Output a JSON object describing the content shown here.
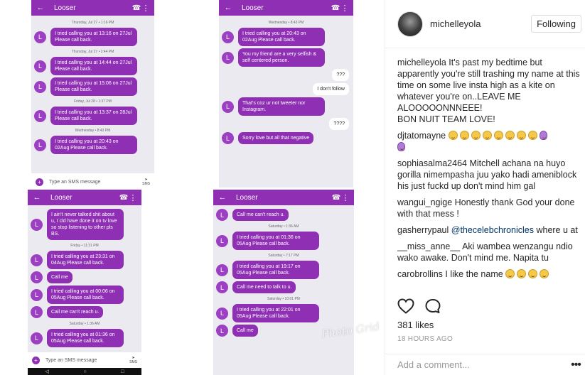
{
  "phones": [
    {
      "title": "Looser",
      "items": [
        {
          "kind": "stamp",
          "text": "Thursday, Jul 27 • 1:16 PM"
        },
        {
          "kind": "in",
          "text": "I tried calling you at 13:16 on 27Jul  Please call back."
        },
        {
          "kind": "stamp",
          "text": "Thursday, Jul 27 • 2:44 PM"
        },
        {
          "kind": "in",
          "text": "I tried calling you at 14:44 on 27Jul  Please call back."
        },
        {
          "kind": "in",
          "text": "I tried calling you at 15:06 on 27Jul  Please call back."
        },
        {
          "kind": "stamp",
          "text": "Friday, Jul 28 • 1:37 PM"
        },
        {
          "kind": "in",
          "text": "I tried calling you at 13:37 on 28Jul  Please call back."
        },
        {
          "kind": "stamp",
          "text": "Wednesday • 8:43 PM"
        },
        {
          "kind": "in",
          "text": "I tried calling you at 20:43 on 02Aug  Please call back."
        }
      ],
      "composer": "Type an SMS message",
      "send": "SMS"
    },
    {
      "title": "Looser",
      "items": [
        {
          "kind": "stamp",
          "text": "Wednesday • 8:43 PM"
        },
        {
          "kind": "in",
          "text": "I tried calling you at 20:43 on 02Aug  Please call back."
        },
        {
          "kind": "in",
          "text": "You my friend are a very selfish & self centered person."
        },
        {
          "kind": "out",
          "text": "???"
        },
        {
          "kind": "out",
          "text": "I don't follow"
        },
        {
          "kind": "in",
          "text": "That's coz ur not tweeter nor Instagram."
        },
        {
          "kind": "out",
          "text": "????"
        },
        {
          "kind": "in",
          "text": "Sorry love but all that negative"
        }
      ]
    },
    {
      "title": "Looser",
      "items": [
        {
          "kind": "in",
          "text": "I ain't never talked shit about u, I cld have done it on tv love so stop listening to other pls BS."
        },
        {
          "kind": "stamp",
          "text": "Friday • 11:31 PM"
        },
        {
          "kind": "in",
          "text": "I tried calling you at 23:31 on 04Aug  Please call back."
        },
        {
          "kind": "in",
          "text": "Call me"
        },
        {
          "kind": "in",
          "text": "I tried calling you at 00:06 on 05Aug  Please call back."
        },
        {
          "kind": "in",
          "text": "Call me can't reach u."
        },
        {
          "kind": "stamp",
          "text": "Saturday • 1:36 AM"
        },
        {
          "kind": "in",
          "text": "I tried calling you at 01:36 on 05Aug  Please call back."
        }
      ],
      "composer": "Type an SMS message",
      "send": "SMS"
    },
    {
      "title": "Looser",
      "items": [
        {
          "kind": "in",
          "text": "Call me can't reach u."
        },
        {
          "kind": "stamp",
          "text": "Saturday • 1:36 AM"
        },
        {
          "kind": "in",
          "text": "I tried calling you at 01:36 on 05Aug  Please call back."
        },
        {
          "kind": "stamp",
          "text": "Saturday • 7:17 PM"
        },
        {
          "kind": "in",
          "text": "I tried calling you at 19:17 on 05Aug  Please call back."
        },
        {
          "kind": "in",
          "text": "Call me need to talk to u."
        },
        {
          "kind": "stamp",
          "text": "Saturday • 10:01 PM"
        },
        {
          "kind": "in",
          "text": "I tried calling you at 22:01 on 05Aug  Please call back."
        },
        {
          "kind": "in",
          "text": "Call me"
        }
      ]
    }
  ],
  "avatar_letter": "L",
  "watermark": "Photo Grid",
  "post": {
    "username": "michelleyola",
    "follow_label": "Following",
    "caption_user": "michelleyola",
    "caption_lines": [
      "It's past my bedtime but apparently you're still trashing my name at this time on some live insta high as a kite on whatever you're on..LEAVE ME ALOOOOONNNEEE!",
      "BON NUIT TEAM LOVE!"
    ],
    "comments": [
      {
        "user": "djtatomayne",
        "text": ""
      },
      {
        "user": "sophiasalma2464",
        "text": "Mitchell achana na huyo gorilla nimempasha juu yako hadi ameniblock his just fuckd up don't mind him gal"
      },
      {
        "user": "wangui_ngige",
        "text": "Honestly thank God your done with that mess !"
      },
      {
        "user": "gasherrypaul",
        "mention": "@thecelebchronicles",
        "text": "where u at"
      },
      {
        "user": "__miss_anne__",
        "text": "Aki wambea wenzangu ndio wako awake. Don't mind me. Napita tu"
      },
      {
        "user": "carobrollins",
        "text": "I like the name"
      }
    ],
    "likes": "381 likes",
    "time_ago": "18 HOURS AGO",
    "comment_placeholder": "Add a comment...",
    "more_label": "•••"
  },
  "colors": {
    "accent": "#8e2fb4",
    "link": "#003569"
  }
}
